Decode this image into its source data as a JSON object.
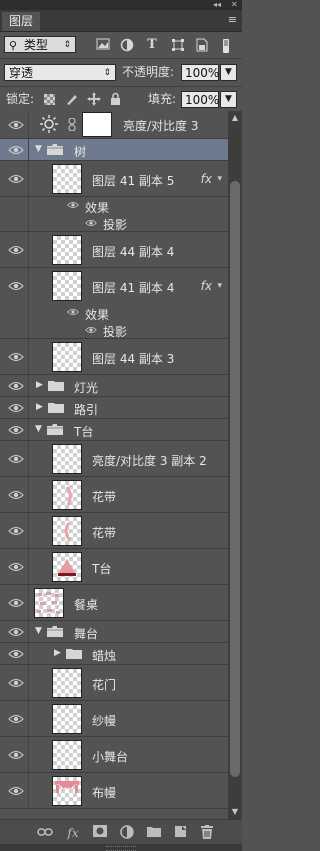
{
  "window": {
    "collapse_glyph": "◂◂",
    "close_glyph": "✕"
  },
  "tab": {
    "label": "图层",
    "menu_glyph": "≡"
  },
  "filter": {
    "kind_label": "类型",
    "search_glyph": "⚲",
    "icons": [
      "image-filter-icon",
      "adjustment-filter-icon",
      "type-filter-icon",
      "shape-filter-icon",
      "smart-object-filter-icon",
      "filter-toggle-icon"
    ]
  },
  "blend": {
    "mode": "穿透",
    "opacity_label": "不透明度:",
    "opacity_value": "100%"
  },
  "lock": {
    "label": "锁定:",
    "fill_label": "填充:",
    "fill_value": "100%"
  },
  "layers": [
    {
      "type": "adjustment",
      "name": "亮度/对比度 3"
    },
    {
      "type": "group",
      "name": "树",
      "expanded": true,
      "selected": true
    },
    {
      "type": "layer",
      "name": "图层 41 副本 5",
      "fx": "fx"
    },
    {
      "type": "effects",
      "name": "效果"
    },
    {
      "type": "effect",
      "name": "投影"
    },
    {
      "type": "layer",
      "name": "图层 44 副本 4"
    },
    {
      "type": "layer",
      "name": "图层 41 副本 4",
      "fx": "fx"
    },
    {
      "type": "effects",
      "name": "效果"
    },
    {
      "type": "effect",
      "name": "投影"
    },
    {
      "type": "layer",
      "name": "图层 44 副本 3"
    },
    {
      "type": "group",
      "name": "灯光",
      "expanded": false
    },
    {
      "type": "group",
      "name": "路引",
      "expanded": false
    },
    {
      "type": "group",
      "name": "T台",
      "expanded": true
    },
    {
      "type": "layer",
      "name": "亮度/对比度 3 副本 2"
    },
    {
      "type": "layer",
      "name": "花带"
    },
    {
      "type": "layer",
      "name": "花带"
    },
    {
      "type": "layer",
      "name": "T台"
    },
    {
      "type": "layer",
      "name": "餐桌"
    },
    {
      "type": "group",
      "name": "舞台",
      "expanded": true
    },
    {
      "type": "subgroup",
      "name": "蜡烛",
      "expanded": false
    },
    {
      "type": "layer",
      "name": "花门"
    },
    {
      "type": "layer",
      "name": "纱幔"
    },
    {
      "type": "layer",
      "name": "小舞台"
    },
    {
      "type": "layer",
      "name": "布幔"
    }
  ],
  "footer": {
    "icons": [
      "link-layers-icon",
      "fx-icon",
      "mask-icon",
      "adjustment-layer-icon",
      "new-group-icon",
      "new-layer-icon",
      "delete-icon"
    ],
    "fx_label": "fx"
  }
}
